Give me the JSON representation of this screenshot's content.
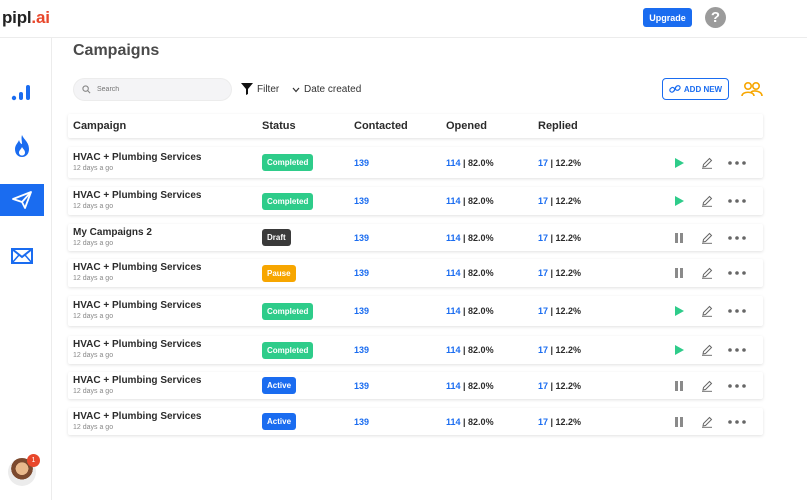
{
  "app": {
    "logo_main": "pipl",
    "logo_dot": ".ai"
  },
  "header": {
    "upgrade_label": "Upgrade",
    "help_label": "?"
  },
  "sidebar": {
    "items": [
      {
        "name": "analytics",
        "icon": "bar-chart-icon",
        "active": false
      },
      {
        "name": "warmup",
        "icon": "flame-icon",
        "active": false
      },
      {
        "name": "campaigns",
        "icon": "send-icon",
        "active": true
      },
      {
        "name": "inbox",
        "icon": "mail-icon",
        "active": false
      }
    ],
    "notification_count": "1"
  },
  "page": {
    "title": "Campaigns"
  },
  "toolbar": {
    "search_placeholder": "Search",
    "filter_label": "Filter",
    "date_label": "Date created",
    "add_new_label": "ADD NEW"
  },
  "table": {
    "headers": [
      "Campaign",
      "Status",
      "Contacted",
      "Opened",
      "Replied"
    ],
    "rows": [
      {
        "name": "HVAC + Plumbing Services",
        "sub": "12 days a go",
        "status": "Completed",
        "contacted": "139",
        "opened_n": "114",
        "opened_p": " | 82.0%",
        "replied_n": "17",
        "replied_p": " | 12.2%",
        "action": "play"
      },
      {
        "name": "HVAC + Plumbing Services",
        "sub": "12 days a go",
        "status": "Completed",
        "contacted": "139",
        "opened_n": "114",
        "opened_p": " | 82.0%",
        "replied_n": "17",
        "replied_p": " | 12.2%",
        "action": "play"
      },
      {
        "name": "My Campaigns 2",
        "sub": "12 days a go",
        "status": "Draft",
        "contacted": "139",
        "opened_n": "114",
        "opened_p": " | 82.0%",
        "replied_n": "17",
        "replied_p": " | 12.2%",
        "action": "pause"
      },
      {
        "name": "HVAC + Plumbing Services",
        "sub": "12 days a go",
        "status": "Pause",
        "contacted": "139",
        "opened_n": "114",
        "opened_p": " | 82.0%",
        "replied_n": "17",
        "replied_p": " | 12.2%",
        "action": "pause"
      },
      {
        "name": "HVAC + Plumbing Services",
        "sub": "12 days a go",
        "status": "Completed",
        "contacted": "139",
        "opened_n": "114",
        "opened_p": " | 82.0%",
        "replied_n": "17",
        "replied_p": " | 12.2%",
        "action": "play"
      },
      {
        "name": "HVAC + Plumbing Services",
        "sub": "12 days a go",
        "status": "Completed",
        "contacted": "139",
        "opened_n": "114",
        "opened_p": " | 82.0%",
        "replied_n": "17",
        "replied_p": " | 12.2%",
        "action": "play"
      },
      {
        "name": "HVAC + Plumbing Services",
        "sub": "12 days a go",
        "status": "Active",
        "contacted": "139",
        "opened_n": "114",
        "opened_p": " | 82.0%",
        "replied_n": "17",
        "replied_p": " | 12.2%",
        "action": "pause"
      },
      {
        "name": "HVAC + Plumbing Services",
        "sub": "12 days a go",
        "status": "Active",
        "contacted": "139",
        "opened_n": "114",
        "opened_p": " | 82.0%",
        "replied_n": "17",
        "replied_p": " | 12.2%",
        "action": "pause"
      }
    ]
  },
  "colors": {
    "accent": "#1a6cf0",
    "completed": "#2ecc8a",
    "draft": "#3a3a3a",
    "pause": "#f7a600",
    "active": "#1a6cf0",
    "play": "#2ecc8a",
    "pause_icon": "#8a8a8a",
    "brand_red": "#e8472b",
    "team_icon": "#f7a600"
  }
}
